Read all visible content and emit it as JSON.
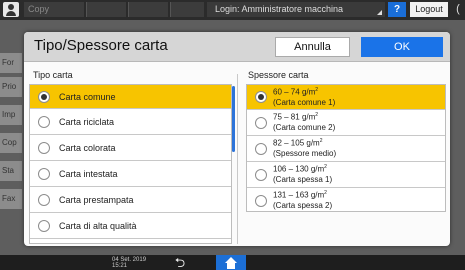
{
  "topbar": {
    "app_name": "Copy",
    "login_text": "Login: Amministratore macchina",
    "help_label": "?",
    "logout_label": "Logout",
    "power_symbol": "(",
    "user_icon": "user-icon"
  },
  "background": {
    "tabs": [
      "For",
      "Prio",
      "Imp",
      "Cop",
      "Sta",
      "Fax"
    ]
  },
  "bottombar": {
    "date": "04 Set. 2019",
    "time": "15:21",
    "back_icon": "back-arrow-icon",
    "home_icon": "home-icon",
    "accent_color": "#1c6fd6"
  },
  "dialog": {
    "title": "Tipo/Spessore carta",
    "cancel_label": "Annulla",
    "ok_label": "OK",
    "ok_color": "#1a73e8",
    "selected_color": "#f7c400",
    "paper_type": {
      "label": "Tipo carta",
      "items": [
        {
          "label": "Carta comune",
          "selected": true
        },
        {
          "label": "Carta riciclata",
          "selected": false
        },
        {
          "label": "Carta colorata",
          "selected": false
        },
        {
          "label": "Carta intestata",
          "selected": false
        },
        {
          "label": "Carta prestampata",
          "selected": false
        },
        {
          "label": "Carta di alta qualità",
          "selected": false
        }
      ]
    },
    "paper_thickness": {
      "label": "Spessore carta",
      "unit": "g/m",
      "unit_sup": "2",
      "items": [
        {
          "range": "60 – 74",
          "desc": "(Carta comune 1)",
          "selected": true
        },
        {
          "range": "75 – 81",
          "desc": "(Carta comune 2)",
          "selected": false
        },
        {
          "range": "82 – 105",
          "desc": "(Spessore medio)",
          "selected": false
        },
        {
          "range": "106 – 130",
          "desc": "(Carta spessa 1)",
          "selected": false
        },
        {
          "range": "131 – 163",
          "desc": "(Carta spessa 2)",
          "selected": false
        }
      ]
    }
  }
}
